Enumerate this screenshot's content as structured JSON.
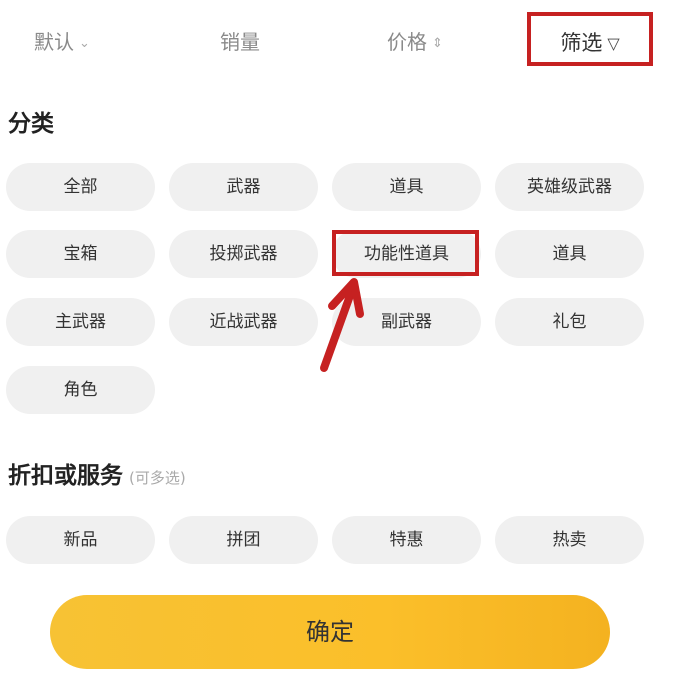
{
  "sort_bar": {
    "default_label": "默认",
    "sales_label": "销量",
    "price_label": "价格",
    "filter_label": "筛选"
  },
  "category": {
    "title": "分类",
    "chips": [
      "全部",
      "武器",
      "道具",
      "英雄级武器",
      "宝箱",
      "投掷武器",
      "功能性道具",
      "道具",
      "主武器",
      "近战武器",
      "副武器",
      "礼包",
      "角色"
    ],
    "highlighted_index": 6
  },
  "service": {
    "title": "折扣或服务",
    "hint": "(可多选)",
    "chips": [
      "新品",
      "拼团",
      "特惠",
      "热卖"
    ]
  },
  "confirm_label": "确定",
  "colors": {
    "highlight_border": "#c62121",
    "confirm_button": "#fbbf2a",
    "chip_background": "#f0f0f0"
  }
}
